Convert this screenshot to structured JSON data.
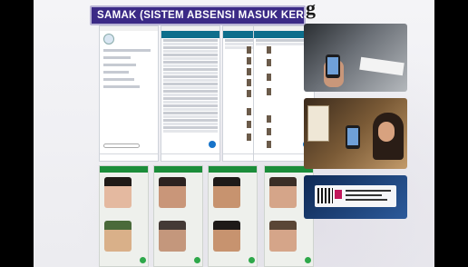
{
  "slide": {
    "title": "SAMAK (SISTEM ABSENSI MASUK KERJA",
    "title_overflow": "g"
  },
  "app_screens": {
    "count": 4,
    "accent_color": "#0d6e8c",
    "fab_color": "#1673c9"
  },
  "attendance_cards": {
    "count": 4,
    "header_color": "#1b8d3a"
  },
  "photos": [
    {
      "name": "photo-scanning-sticker",
      "icon": "camera-icon"
    },
    {
      "name": "photo-woman-with-phone",
      "icon": "camera-icon"
    },
    {
      "name": "photo-qr-sticker",
      "icon": "qr-code-icon"
    }
  ],
  "colors": {
    "title_bg": "#3b2a86",
    "title_border": "#b9b4d6",
    "background": "#000000"
  }
}
